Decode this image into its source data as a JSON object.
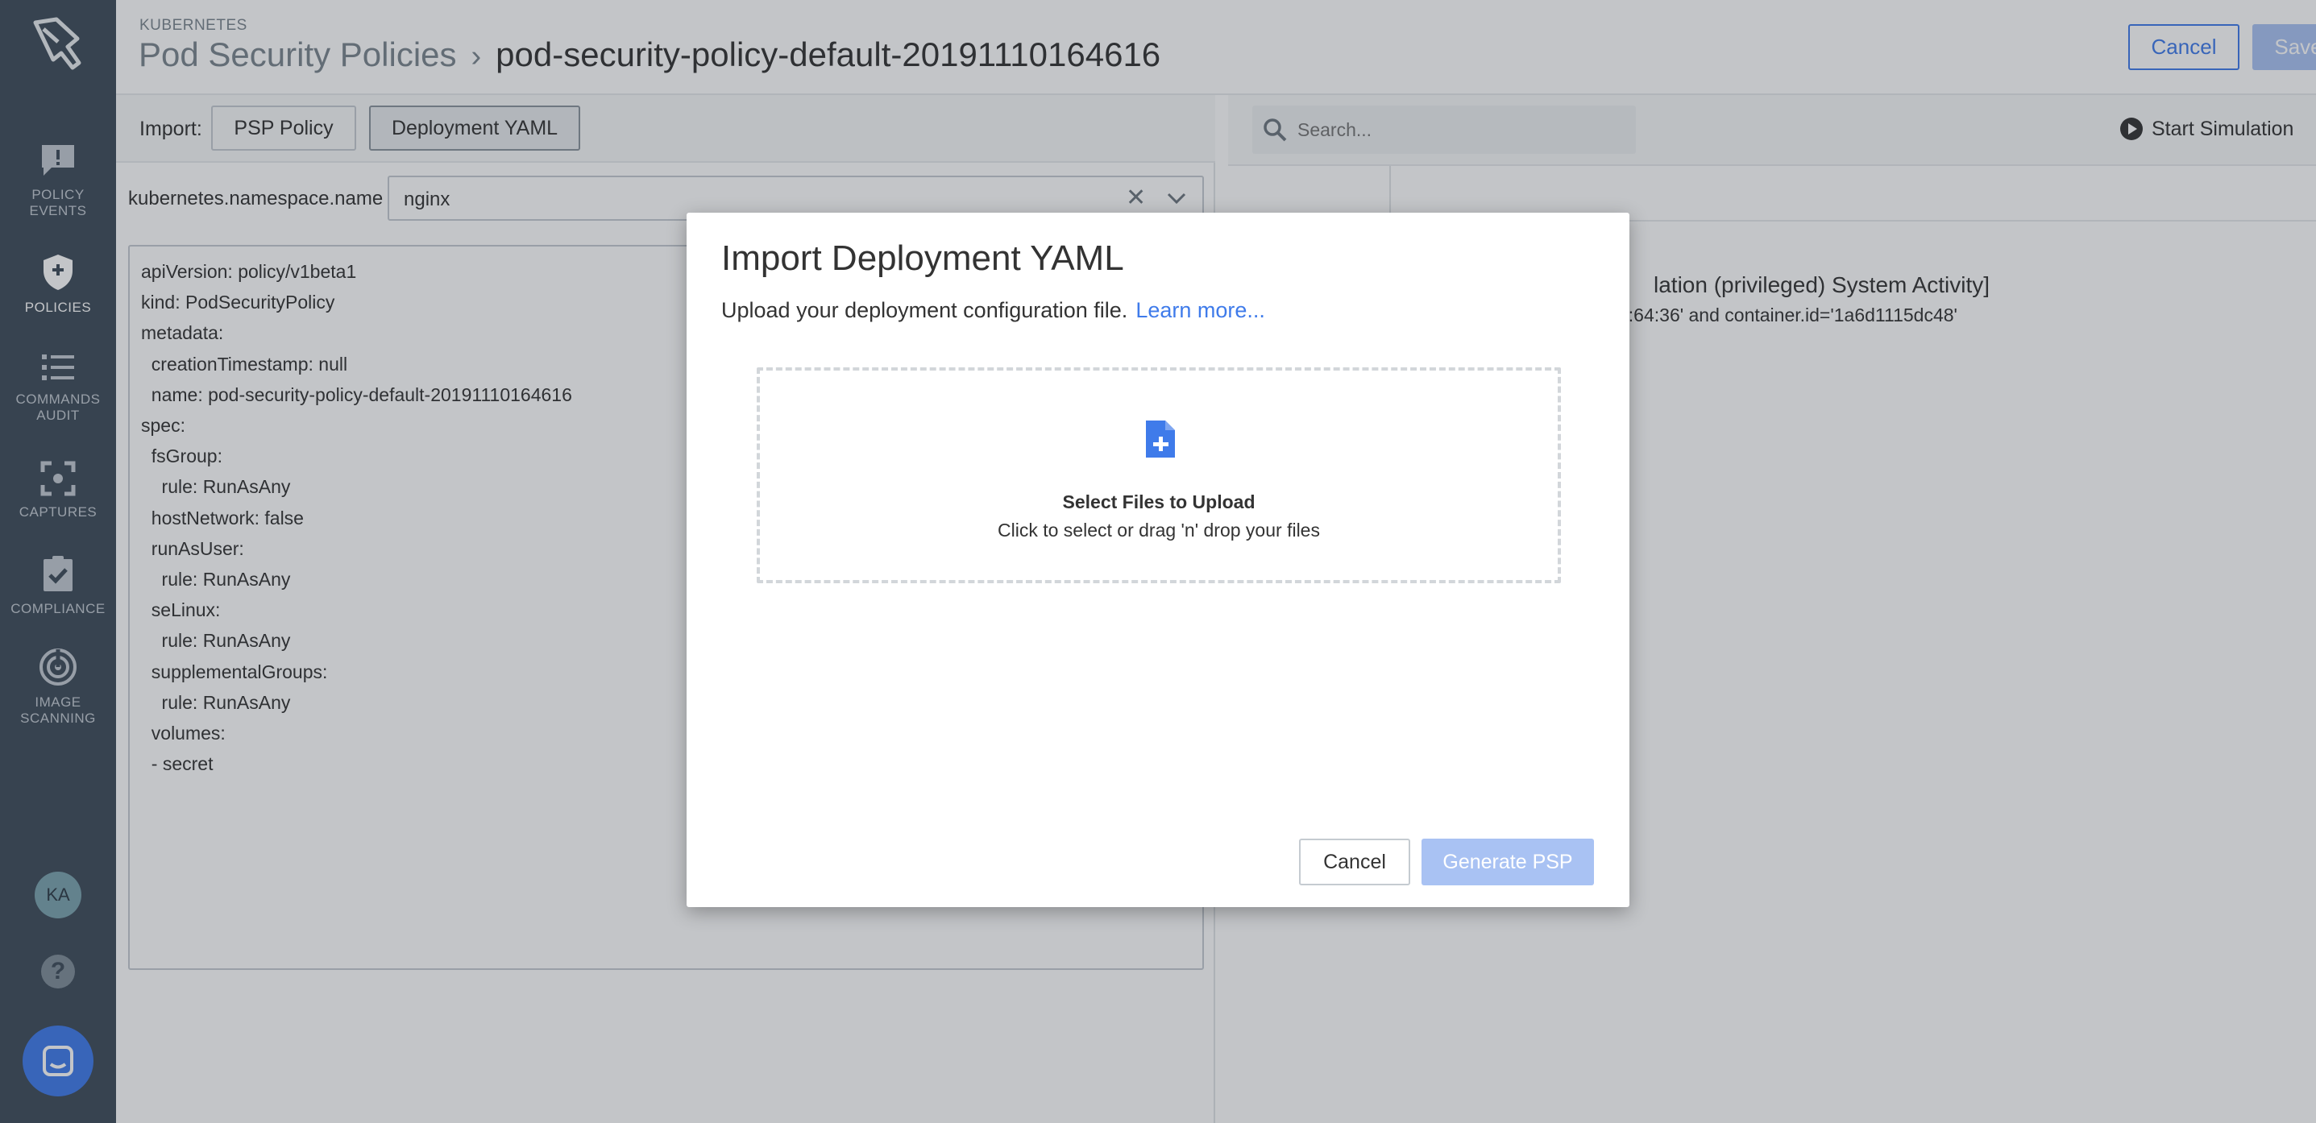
{
  "sidebar": {
    "items": [
      {
        "icon": "policy-events-icon",
        "label_1": "POLICY",
        "label_2": "EVENTS"
      },
      {
        "icon": "policies-icon",
        "label_1": "POLICIES",
        "label_2": ""
      },
      {
        "icon": "commands-audit-icon",
        "label_1": "COMMANDS",
        "label_2": "AUDIT"
      },
      {
        "icon": "captures-icon",
        "label_1": "CAPTURES",
        "label_2": ""
      },
      {
        "icon": "compliance-icon",
        "label_1": "COMPLIANCE",
        "label_2": ""
      },
      {
        "icon": "image-scanning-icon",
        "label_1": "IMAGE",
        "label_2": "SCANNING"
      }
    ],
    "active": "POLICIES",
    "avatar": "KA",
    "help": "?"
  },
  "header": {
    "section": "KUBERNETES",
    "breadcrumb_root": "Pod Security Policies",
    "breadcrumb_sep": "›",
    "breadcrumb_current": "pod-security-policy-default-20191110164616",
    "cancel": "Cancel",
    "save": "Save"
  },
  "import_bar": {
    "label": "Import:",
    "psp_button": "PSP Policy",
    "yaml_button": "Deployment YAML"
  },
  "namespace": {
    "label": "kubernetes.namespace.name",
    "value": "nginx",
    "clear": "✕"
  },
  "yaml": [
    "apiVersion: policy/v1beta1",
    "kind: PodSecurityPolicy",
    "metadata:",
    "  creationTimestamp: null",
    "  name: pod-security-policy-default-20191110164616",
    "spec:",
    "  fsGroup:",
    "    rule: RunAsAny",
    "  hostNetwork: false",
    "  runAsUser:",
    "    rule: RunAsAny",
    "  seLinux:",
    "    rule: RunAsAny",
    "  supplementalGroups:",
    "    rule: RunAsAny",
    "  volumes:",
    "  - secret"
  ],
  "right_panel": {
    "search_placeholder": "Search...",
    "simulation": "Start Simulation",
    "event_title": "lation (privileged) System Activity]",
    "event_detail": "1:64:36' and container.id='1a6d1115dc48'"
  },
  "modal": {
    "title": "Import Deployment YAML",
    "subtitle": "Upload your deployment configuration file.",
    "learn_more": "Learn more...",
    "drop_title": "Select Files to Upload",
    "drop_sub": "Click to select or drag 'n' drop your files",
    "cancel": "Cancel",
    "generate": "Generate PSP"
  },
  "colors": {
    "sidebar": "#3d4b59",
    "accent": "#3f7bea",
    "disabled_primary": "#a9c2f3"
  }
}
